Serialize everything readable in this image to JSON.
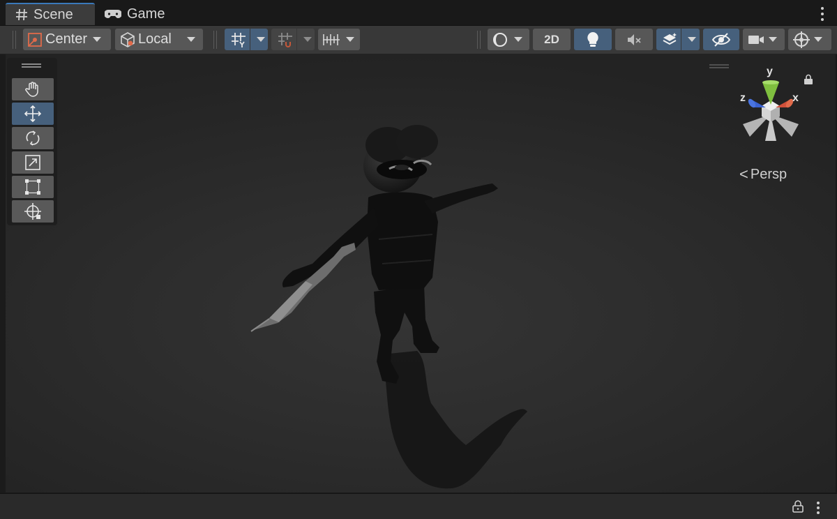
{
  "tabs": {
    "scene_label": "Scene",
    "game_label": "Game",
    "scene_icon": "grid-hash-icon",
    "game_icon": "gamepad-icon"
  },
  "toolbar": {
    "pivot_label": "Center",
    "handle_rotation_label": "Local",
    "view_2d_label": "2D",
    "grid_snap_icon": "grid-snap-icon",
    "increment_snap_icon": "increment-snap-icon",
    "ruler_icon": "ruler-snap-icon",
    "shading_icon": "shading-mode-icon",
    "lighting_icon": "lightbulb-icon",
    "audio_icon": "audio-muted-icon",
    "fx_icon": "effects-layers-icon",
    "visibility_icon": "hidden-eye-icon",
    "camera_icon": "scene-camera-icon",
    "gizmos_icon": "gizmos-icon"
  },
  "tools": [
    {
      "name": "hand-tool",
      "icon": "hand-icon",
      "active": false
    },
    {
      "name": "move-tool",
      "icon": "move-arrows-icon",
      "active": true
    },
    {
      "name": "rotate-tool",
      "icon": "rotate-icon",
      "active": false
    },
    {
      "name": "scale-tool",
      "icon": "scale-icon",
      "active": false
    },
    {
      "name": "rect-tool",
      "icon": "rect-transform-icon",
      "active": false
    },
    {
      "name": "transform-tool",
      "icon": "transform-icon",
      "active": false
    }
  ],
  "gizmo": {
    "y_label": "y",
    "x_label": "x",
    "z_label": "z",
    "projection_label": "Persp",
    "colors": {
      "x": "#d0503a",
      "y": "#7fbf3f",
      "z": "#3a62d0"
    }
  },
  "colors": {
    "accent": "#46607c",
    "tab_highlight": "#3a79bb",
    "toolbar_bg": "#383838",
    "button_bg": "#575757"
  }
}
